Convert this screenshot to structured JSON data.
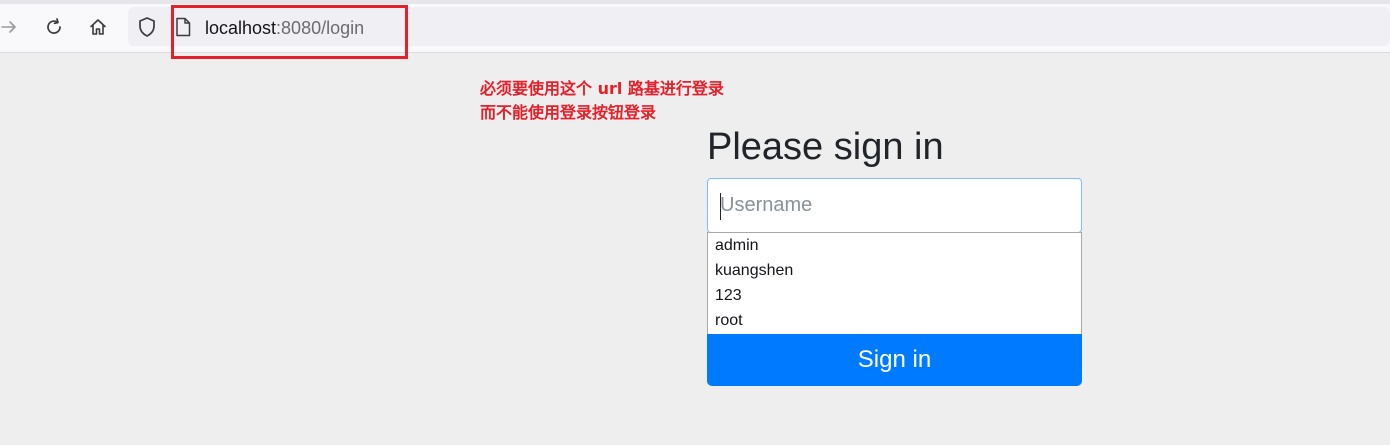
{
  "browser": {
    "icons": {
      "forward": "forward-arrow-icon",
      "reload": "reload-icon",
      "home": "home-icon",
      "tracking": "shield-icon",
      "page": "page-icon"
    },
    "url_host": "localhost",
    "url_rest": ":8080/login"
  },
  "annotation": {
    "line1": "必须要使用这个 url 路基进行登录",
    "line2": "而不能使用登录按钮登录",
    "color": "#e5202a"
  },
  "login": {
    "heading": "Please sign in",
    "username_placeholder": "Username",
    "autocomplete": [
      "admin",
      "kuangshen",
      "123",
      "root"
    ],
    "submit_label": "Sign in",
    "accent_color": "#007bff"
  }
}
